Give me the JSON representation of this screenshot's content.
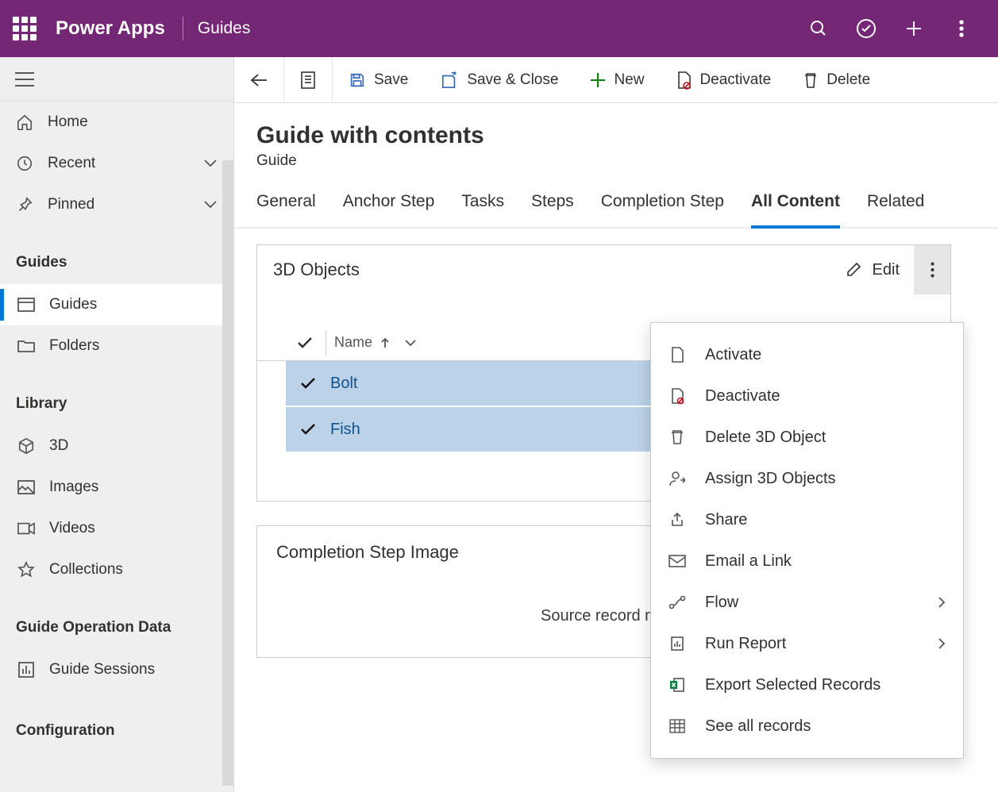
{
  "header": {
    "brand": "Power Apps",
    "appname": "Guides"
  },
  "sidebar": {
    "nav": [
      {
        "label": "Home"
      },
      {
        "label": "Recent"
      },
      {
        "label": "Pinned"
      }
    ],
    "sections": {
      "guides": {
        "header": "Guides",
        "items": [
          {
            "label": "Guides"
          },
          {
            "label": "Folders"
          }
        ]
      },
      "library": {
        "header": "Library",
        "items": [
          {
            "label": "3D"
          },
          {
            "label": "Images"
          },
          {
            "label": "Videos"
          },
          {
            "label": "Collections"
          }
        ]
      },
      "opdata": {
        "header": "Guide Operation Data",
        "items": [
          {
            "label": "Guide Sessions"
          }
        ]
      },
      "config": {
        "header": "Configuration"
      }
    }
  },
  "cmd": {
    "save": "Save",
    "saveclose": "Save & Close",
    "new": "New",
    "deactivate": "Deactivate",
    "delete": "Delete"
  },
  "record": {
    "title": "Guide with contents",
    "entity": "Guide"
  },
  "tabs": [
    {
      "label": "General"
    },
    {
      "label": "Anchor Step"
    },
    {
      "label": "Tasks"
    },
    {
      "label": "Steps"
    },
    {
      "label": "Completion Step"
    },
    {
      "label": "All Content",
      "active": true
    },
    {
      "label": "Related"
    }
  ],
  "subgrid": {
    "title": "3D Objects",
    "edit": "Edit",
    "col_name": "Name",
    "rows": [
      {
        "name": "Bolt"
      },
      {
        "name": "Fish"
      }
    ]
  },
  "completion": {
    "title": "Completion Step Image",
    "message": "Source record not"
  },
  "ctx": {
    "items": [
      {
        "label": "Activate"
      },
      {
        "label": "Deactivate"
      },
      {
        "label": "Delete 3D Object"
      },
      {
        "label": "Assign 3D Objects"
      },
      {
        "label": "Share"
      },
      {
        "label": "Email a Link"
      },
      {
        "label": "Flow",
        "submenu": true
      },
      {
        "label": "Run Report",
        "submenu": true
      },
      {
        "label": "Export Selected Records"
      },
      {
        "label": "See all records"
      }
    ]
  }
}
